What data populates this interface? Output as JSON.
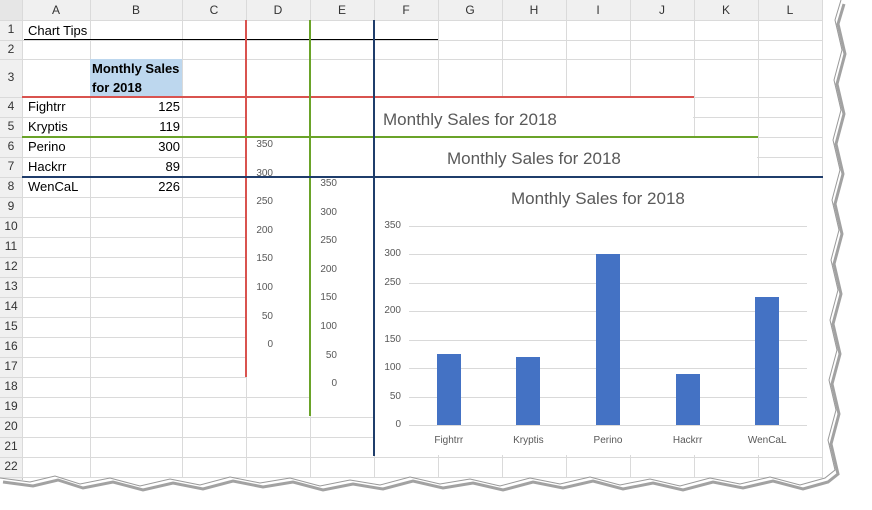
{
  "sheet": {
    "columns": [
      "A",
      "B",
      "C",
      "D",
      "E",
      "F",
      "G",
      "H",
      "I",
      "J",
      "K",
      "L"
    ],
    "rows": [
      "1",
      "2",
      "3",
      "4",
      "5",
      "6",
      "7",
      "8",
      "9",
      "10",
      "11",
      "12",
      "13",
      "14",
      "15",
      "16",
      "17",
      "18",
      "19",
      "20",
      "21",
      "22"
    ],
    "a1": "Chart Tips",
    "header_b3_line1": "Monthly Sales",
    "header_b3_line2": "for 2018",
    "names": [
      "Fightrr",
      "Kryptis",
      "Perino",
      "Hackrr",
      "WenCaL"
    ],
    "values": [
      "125",
      "119",
      "300",
      "89",
      "226"
    ],
    "colors": {
      "header_fill": "#bdd7ee",
      "red": "#d9534f",
      "green": "#6aa329",
      "navy": "#1f3d6b"
    }
  },
  "chart_back_title": "Monthly Sales for 2018",
  "chart_mid_title": "Monthly Sales for 2018",
  "axis_ticks": [
    "350",
    "300",
    "250",
    "200",
    "150",
    "100",
    "50",
    "0"
  ],
  "chart_data": {
    "type": "bar",
    "title": "Monthly Sales for 2018",
    "categories": [
      "Fightrr",
      "Kryptis",
      "Perino",
      "Hackrr",
      "WenCaL"
    ],
    "values": [
      125,
      119,
      300,
      89,
      226
    ],
    "ylim": [
      0,
      350
    ],
    "yticks": [
      0,
      50,
      100,
      150,
      200,
      250,
      300,
      350
    ],
    "grid": true,
    "color": "#4472c4"
  }
}
